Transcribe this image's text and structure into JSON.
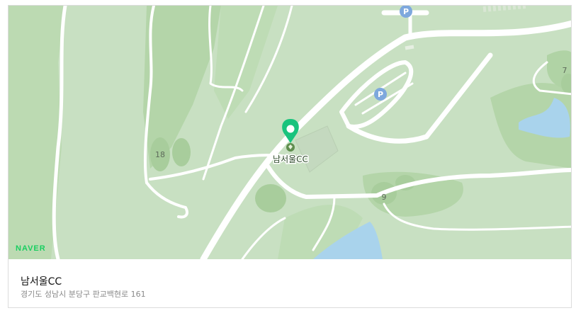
{
  "map": {
    "provider_logo": "NAVER",
    "marker_label": "남서울CC",
    "hole_numbers": [
      "18",
      "9",
      "7"
    ],
    "parking_symbol": "P",
    "colors": {
      "land": "#c8e0c2",
      "fairway": "#b6d6ab",
      "rough": "#a8cd9c",
      "water": "#a9d3ec",
      "road": "#ffffff",
      "marker": "#19c37d",
      "parking": "#7ea8dd",
      "logo": "#19ce60"
    },
    "icons": [
      "map-marker-icon",
      "golf-course-icon",
      "parking-icon"
    ]
  },
  "place": {
    "name": "남서울CC",
    "address": "경기도 성남시 분당구 판교백현로 161"
  }
}
